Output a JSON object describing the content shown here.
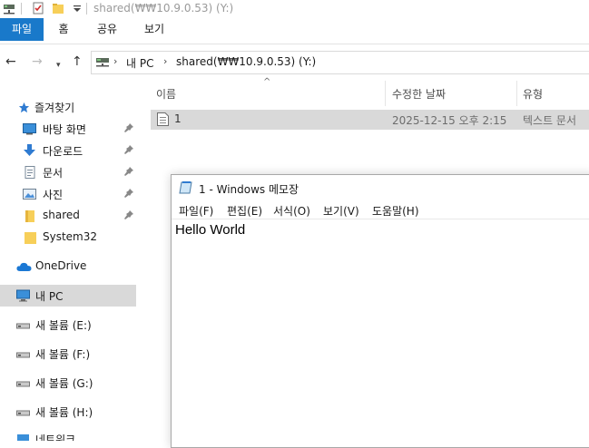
{
  "window": {
    "title": "shared(₩₩10.9.0.53) (Y:)"
  },
  "ribbon": {
    "tabs": [
      "파일",
      "홈",
      "공유",
      "보기"
    ]
  },
  "address": {
    "segments": [
      "내 PC",
      "shared(₩₩10.9.0.53) (Y:)"
    ]
  },
  "nav": {
    "quick_access": "즐겨찾기",
    "items": [
      {
        "label": "바탕 화면",
        "icon": "desktop-icon",
        "pinned": true
      },
      {
        "label": "다운로드",
        "icon": "download-icon",
        "pinned": true
      },
      {
        "label": "문서",
        "icon": "document-icon",
        "pinned": true
      },
      {
        "label": "사진",
        "icon": "pictures-icon",
        "pinned": true
      },
      {
        "label": "shared",
        "icon": "folder-icon",
        "pinned": true
      },
      {
        "label": "System32",
        "icon": "folder-icon",
        "pinned": false
      }
    ],
    "onedrive": "OneDrive",
    "this_pc": "내 PC",
    "drives": [
      "새 볼륨 (E:)",
      "새 볼륨 (F:)",
      "새 볼륨 (G:)",
      "새 볼륨 (H:)"
    ],
    "network": "네트워크"
  },
  "filelist": {
    "columns": [
      "이름",
      "수정한 날짜",
      "유형"
    ],
    "rows": [
      {
        "name": "1",
        "modified": "2025-12-15 오후 2:15",
        "type": "텍스트 문서"
      }
    ]
  },
  "notepad": {
    "title": "1 - Windows 메모장",
    "menus": [
      "파일(F)",
      "편집(E)",
      "서식(O)",
      "보기(V)",
      "도움말(H)"
    ],
    "content": "Hello World"
  },
  "colors": {
    "accent": "#1979ca",
    "selection": "#d9d9d9"
  }
}
